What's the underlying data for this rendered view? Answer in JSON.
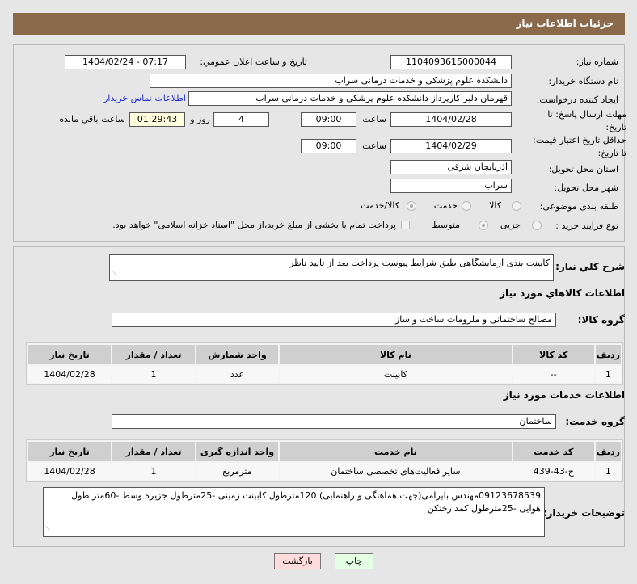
{
  "header": {
    "title": "جزئیات اطلاعات نیاز"
  },
  "form": {
    "need_number_label": "شماره نیاز:",
    "need_number": "1104093615000044",
    "announce_label": "تاریخ و ساعت اعلان عمومي:",
    "announce_value": "1404/02/24 - 07:17",
    "buyer_org_label": "نام دستگاه خریدار:",
    "buyer_org": "دانشکده علوم پزشکی و خدمات درمانی سراب",
    "creator_label": "ایجاد کننده درخواست:",
    "creator": "قهرمان دلیر کارپرداز دانشکده علوم پزشکی و خدمات درمانی سراب",
    "contact_link": "اطلاعات تماس خریدار",
    "deadline_label": "مهلت ارسال پاسخ: تا تاریخ:",
    "deadline_date": "1404/02/28",
    "time_label": "ساعت",
    "deadline_time": "09:00",
    "days": "4",
    "days_label": "روز و",
    "remaining": "01:29:43",
    "remaining_label": "ساعت باقي مانده",
    "validity_label": "حداقل تاریخ اعتبار قیمت: تا تاریخ:",
    "validity_date": "1404/02/29",
    "validity_time": "09:00",
    "province_label": "استان محل تحویل:",
    "province": "آذربایجان شرقی",
    "city_label": "شهر محل تحویل:",
    "city": "سراب",
    "category_label": "طبقه بندی موضوعی:",
    "category_options": [
      "کالا",
      "خدمت",
      "کالا/خدمت"
    ],
    "category_selected": "کالا/خدمت",
    "process_label": "نوع فرآیند خرید :",
    "process_options": [
      "جزیی",
      "متوسط"
    ],
    "payment_note": "پرداخت تمام یا بخشی از مبلغ خرید،از محل \"اسناد خزانه اسلامی\" خواهد بود."
  },
  "details": {
    "summary_label": "شرح کلي نیاز:",
    "summary": "کابینت بندی آزمایشگاهی طبق شرایط پیوست پرداخت بعد از تایید ناظر",
    "goods_title": "اطلاعات کالاهاي مورد نیاز",
    "goods_group_label": "گروه کالا:",
    "goods_group": "مصالح ساختمانی و ملزومات ساخت و ساز",
    "goods_headers": [
      "ردیف",
      "کد کالا",
      "نام کالا",
      "واحد شمارش",
      "تعداد / مقدار",
      "تاریخ نیاز"
    ],
    "goods_rows": [
      [
        "1",
        "--",
        "کابینت",
        "عدد",
        "1",
        "1404/02/28"
      ]
    ],
    "services_title": "اطلاعات خدمات مورد نیاز",
    "service_group_label": "گروه خدمت:",
    "service_group": "ساختمان",
    "service_headers": [
      "ردیف",
      "کد خدمت",
      "نام خدمت",
      "واحد اندازه گیری",
      "تعداد / مقدار",
      "تاریخ نیاز"
    ],
    "service_rows": [
      [
        "1",
        "ج-43-439",
        "سایر فعالیت‌های تخصصی ساختمان",
        "مترمربع",
        "1",
        "1404/02/28"
      ]
    ],
    "buyer_notes_label": "توضیحات خریدار:",
    "buyer_notes": "09123678539مهندس بایرامی(جهت هماهنگی و راهنمایی) 120مترطول کابینت زمینی -25مترطول جزیره وسط -60متر طول هوایی -25مترطول کمد رختکن"
  },
  "buttons": {
    "print": "چاپ",
    "back": "بازگشت"
  }
}
